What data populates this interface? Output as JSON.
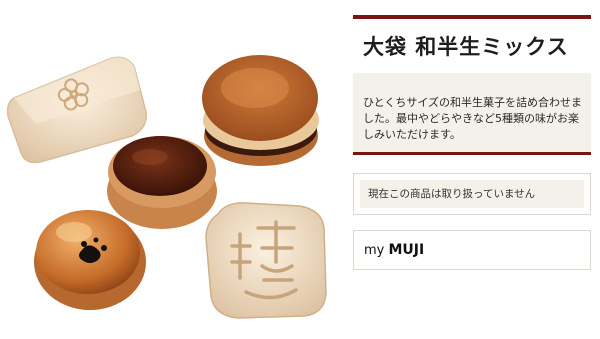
{
  "product": {
    "title": "大袋 和半生ミックス",
    "description": "ひとくちサイズの和半生菓子を詰め合わせました。最中やどらやきなど5種類の味がお楽しみいただけます。"
  },
  "status": {
    "message": "現在この商品は取り扱っていません"
  },
  "mymuji": {
    "prefix": "my",
    "brand": "MUJI"
  },
  "colors": {
    "accent": "#7a1516",
    "panel_bg": "#f4f1ea",
    "border": "#dcd8cf"
  }
}
